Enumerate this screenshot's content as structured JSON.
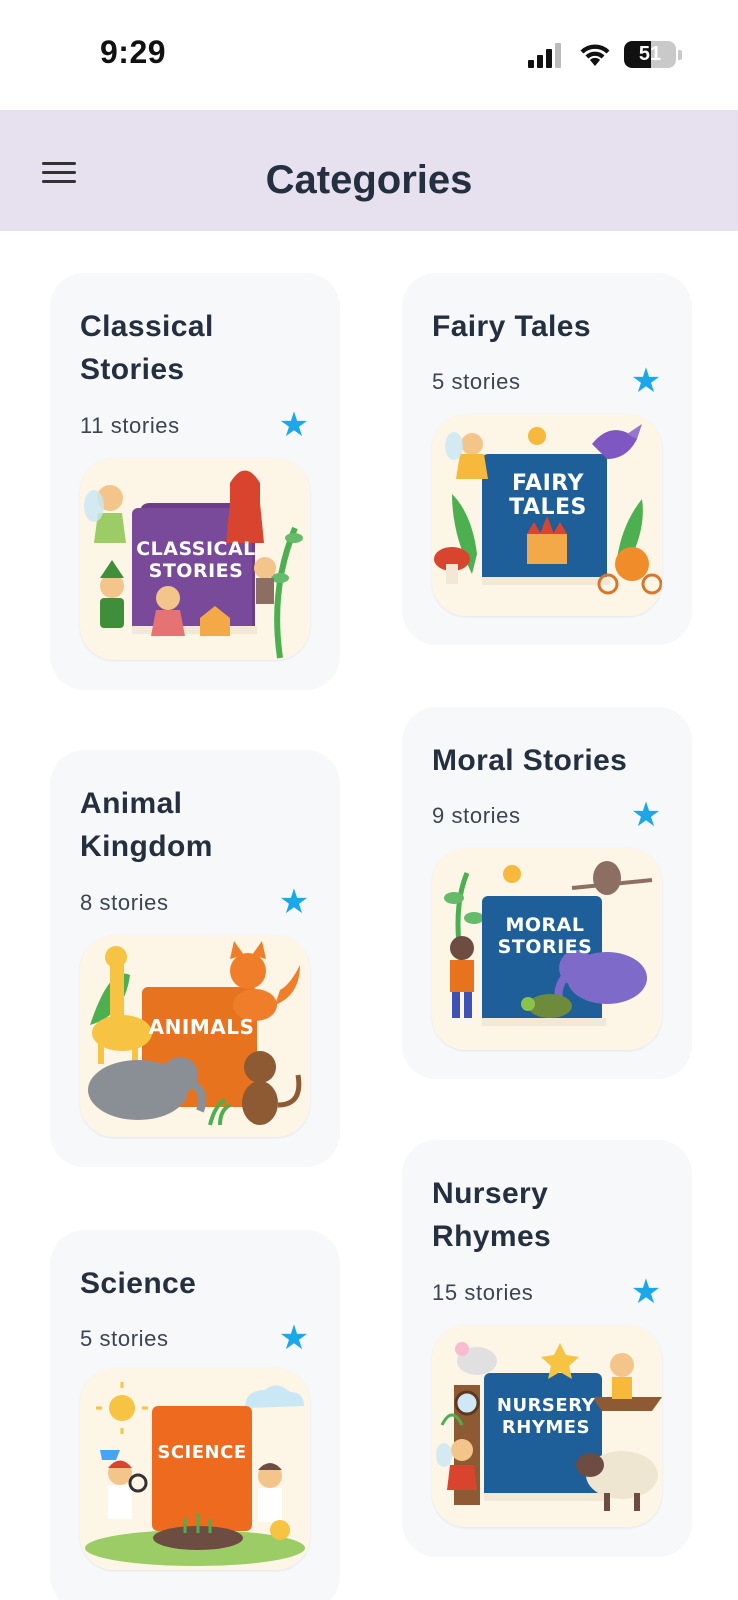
{
  "status_bar": {
    "time": "9:29",
    "battery": "51",
    "battery_level": 0.51,
    "icons": [
      "signal-icon",
      "wifi-icon",
      "battery-icon"
    ]
  },
  "header": {
    "title": "Categories",
    "menu_icon": "hamburger-menu-icon",
    "background": "#e6e0ef"
  },
  "accent_color": "#1aa8e8",
  "categories": [
    {
      "title": "Classical Stories",
      "count": "11 stories",
      "cover_text": "CLASSICAL STORIES",
      "cover_color": "#7a4a9a",
      "favorite_icon": "star-icon"
    },
    {
      "title": "Fairy Tales",
      "count": "5 stories",
      "cover_text": "FAIRY TALES",
      "cover_color": "#1f5f99",
      "favorite_icon": "star-icon"
    },
    {
      "title": "Animal Kingdom",
      "count": "8 stories",
      "cover_text": "ANIMALS",
      "cover_color": "#e8731f",
      "favorite_icon": "star-icon"
    },
    {
      "title": "Moral Stories",
      "count": "9 stories",
      "cover_text": "MORAL STORIES",
      "cover_color": "#1f5f99",
      "favorite_icon": "star-icon"
    },
    {
      "title": "Science",
      "count": "5 stories",
      "cover_text": "SCIENCE",
      "cover_color": "#ee6a1e",
      "favorite_icon": "star-icon"
    },
    {
      "title": "Nursery Rhymes",
      "count": "15 stories",
      "cover_text": "NURSERY RHYMES",
      "cover_color": "#1f5f99",
      "favorite_icon": "star-icon"
    }
  ]
}
